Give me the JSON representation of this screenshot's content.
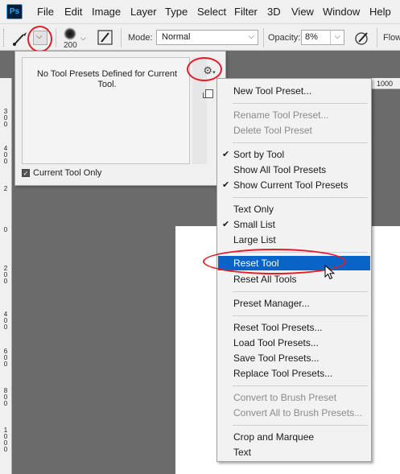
{
  "app": {
    "logo": "Ps"
  },
  "menubar": {
    "items": [
      {
        "label": "File"
      },
      {
        "label": "Edit"
      },
      {
        "label": "Image"
      },
      {
        "label": "Layer"
      },
      {
        "label": "Type"
      },
      {
        "label": "Select"
      },
      {
        "label": "Filter"
      },
      {
        "label": "3D"
      },
      {
        "label": "View"
      },
      {
        "label": "Window"
      },
      {
        "label": "Help"
      }
    ]
  },
  "options": {
    "brush_size": "200",
    "mode_label": "Mode:",
    "mode_value": "Normal",
    "opacity_label": "Opacity:",
    "opacity_value": "8%",
    "flow_label": "Flow",
    "chevron": "⌵"
  },
  "presets_panel": {
    "empty_text": "No Tool Presets Defined for Current Tool.",
    "current_tool_only_label": "Current Tool Only",
    "current_tool_only_checked": true,
    "gear_icon": "⚙"
  },
  "ruler": {
    "top_label": "1000",
    "left_labels": [
      "3\n0\n0",
      "4\n0\n0",
      "2",
      "0",
      "2\n0\n0",
      "4\n0\n0",
      "6\n0\n0",
      "8\n0\n0",
      "1\n0\n0\n0"
    ]
  },
  "menu": {
    "items": [
      {
        "label": "New Tool Preset...",
        "enabled": true
      },
      {
        "label": "Rename Tool Preset...",
        "enabled": false
      },
      {
        "label": "Delete Tool Preset",
        "enabled": false
      },
      {
        "label": "Sort by Tool",
        "enabled": true,
        "checked": true
      },
      {
        "label": "Show All Tool Presets",
        "enabled": true
      },
      {
        "label": "Show Current Tool Presets",
        "enabled": true,
        "checked": true
      },
      {
        "label": "Text Only",
        "enabled": true
      },
      {
        "label": "Small List",
        "enabled": true,
        "checked": true
      },
      {
        "label": "Large List",
        "enabled": true
      },
      {
        "label": "Reset Tool",
        "enabled": true,
        "highlighted": true
      },
      {
        "label": "Reset All Tools",
        "enabled": true
      },
      {
        "label": "Preset Manager...",
        "enabled": true
      },
      {
        "label": "Reset Tool Presets...",
        "enabled": true
      },
      {
        "label": "Load Tool Presets...",
        "enabled": true
      },
      {
        "label": "Save Tool Presets...",
        "enabled": true
      },
      {
        "label": "Replace Tool Presets...",
        "enabled": true
      },
      {
        "label": "Convert to Brush Preset",
        "enabled": false
      },
      {
        "label": "Convert All to Brush Presets...",
        "enabled": false
      },
      {
        "label": "Crop and Marquee",
        "enabled": true
      },
      {
        "label": "Text",
        "enabled": true
      }
    ],
    "check_glyph": "✔"
  },
  "colors": {
    "highlight": "#0a64c8",
    "annotation_red": "#e11d2a",
    "workspace_gray": "#6b6b6b"
  }
}
